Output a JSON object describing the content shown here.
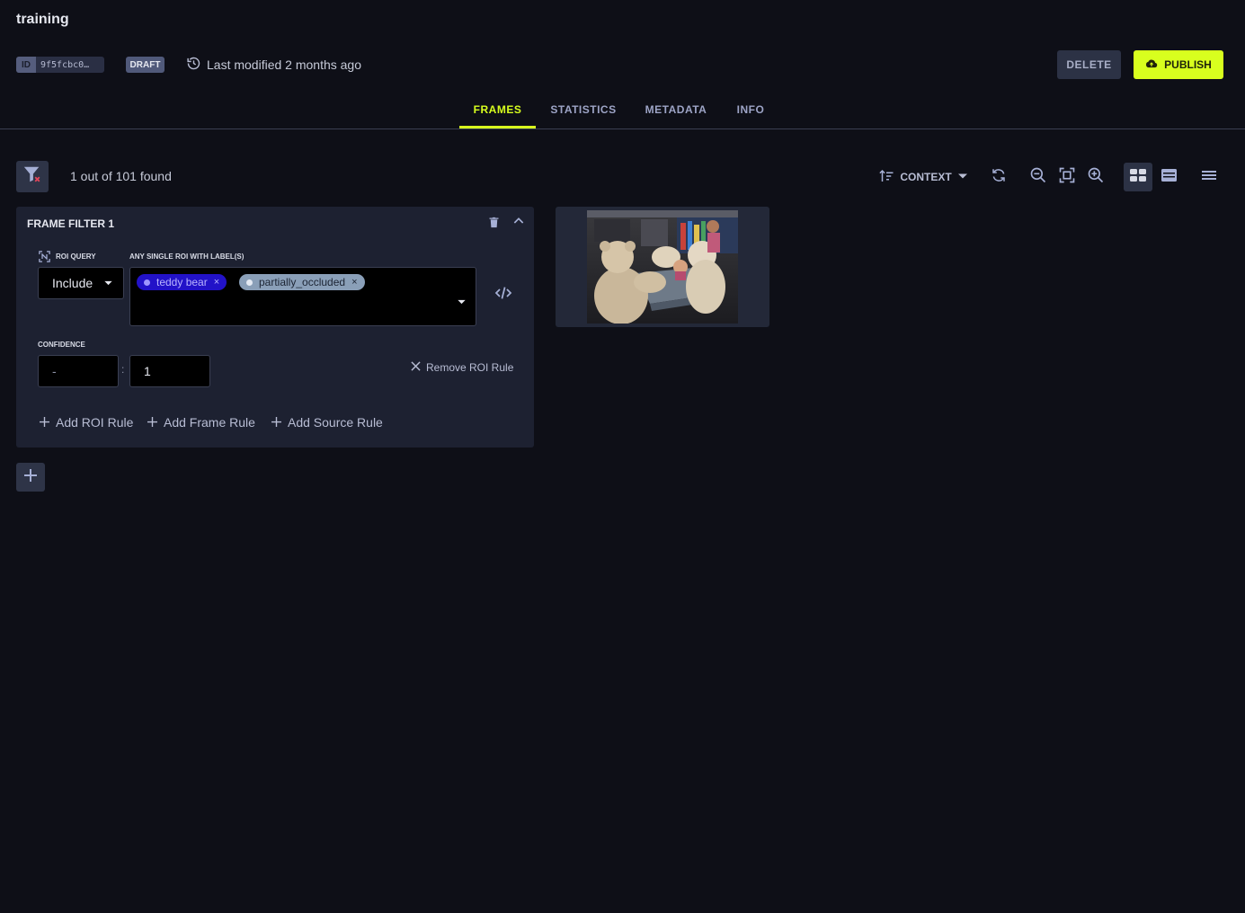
{
  "header": {
    "title": "training",
    "id_label": "ID",
    "id_value": "9f5fcbc0…",
    "status": "DRAFT",
    "last_modified": "Last modified 2 months ago",
    "delete_label": "DELETE",
    "publish_label": "PUBLISH"
  },
  "tabs": [
    {
      "label": "FRAMES",
      "active": true
    },
    {
      "label": "STATISTICS",
      "active": false
    },
    {
      "label": "METADATA",
      "active": false
    },
    {
      "label": "INFO",
      "active": false
    }
  ],
  "toolbar": {
    "found_text": "1 out of 101 found",
    "sort_label": "CONTEXT"
  },
  "filter_panel": {
    "title": "FRAME FILTER 1",
    "roi_query_label": "ROI QUERY",
    "roi_query_value": "Include",
    "labels_title": "ANY SINGLE ROI WITH LABEL(S)",
    "labels": [
      {
        "label": "teddy bear",
        "color": "#2212c8"
      },
      {
        "label": "partially_occluded",
        "color": "#8a9fb8"
      }
    ],
    "remove_x": "×",
    "confidence_label": "CONFIDENCE",
    "confidence_min": "-",
    "confidence_separator": ":",
    "confidence_max": "1",
    "remove_rule": "Remove ROI Rule",
    "add_roi_rule": "Add ROI Rule",
    "add_frame_rule": "Add Frame Rule",
    "add_source_rule": "Add Source Rule"
  },
  "colors": {
    "accent": "#d8ff1e",
    "background": "#0e0f17",
    "panel": "#1d2131"
  },
  "icons": [
    "history-icon",
    "cloud-upload-icon",
    "filter-clear-icon",
    "sort-icon",
    "refresh-icon",
    "zoom-out-icon",
    "fit-screen-icon",
    "zoom-in-icon",
    "grid-view-icon",
    "list-view-icon",
    "menu-icon",
    "trash-icon",
    "chevron-up-icon",
    "roi-icon",
    "code-icon",
    "close-icon",
    "plus-icon"
  ]
}
